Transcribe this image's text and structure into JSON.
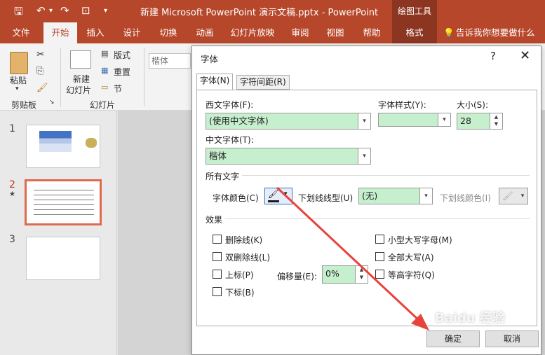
{
  "window": {
    "title": "新建 Microsoft PowerPoint 演示文稿.pptx  -  PowerPoint",
    "context_tab_group": "绘图工具"
  },
  "ribbon_tabs": [
    "文件",
    "开始",
    "插入",
    "设计",
    "切换",
    "动画",
    "幻灯片放映",
    "审阅",
    "视图",
    "帮助",
    "格式"
  ],
  "tell_me": "告诉我你想要做什么",
  "ribbon": {
    "paste": "粘贴",
    "clipboard_group": "剪贴板",
    "new_slide_line1": "新建",
    "new_slide_line2": "幻灯片",
    "layout": "版式",
    "reset": "重置",
    "section": "节",
    "slides_group": "幻灯片",
    "font_box": "楷体"
  },
  "slides": [
    "1",
    "2",
    "3"
  ],
  "slide2_star": "★",
  "dialog": {
    "title": "字体",
    "help": "?",
    "close": "✕",
    "tab_font": "字体(N)",
    "tab_spacing": "字符间距(R)",
    "western_font_label": "西文字体(F):",
    "western_font_value": "(使用中文字体)",
    "font_style_label": "字体样式(Y):",
    "font_style_value": "",
    "size_label": "大小(S):",
    "size_value": "28",
    "chinese_font_label": "中文字体(T):",
    "chinese_font_value": "楷体",
    "all_text_section": "所有文字",
    "font_color_label": "字体颜色(C)",
    "underline_type_label": "下划线线型(U)",
    "underline_type_value": "(无)",
    "underline_color_label": "下划线颜色(I)",
    "effects_section": "效果",
    "strike": "删除线(K)",
    "double_strike": "双删除线(L)",
    "superscript": "上标(P)",
    "subscript": "下标(B)",
    "offset_label": "偏移量(E):",
    "offset_value": "0%",
    "small_caps": "小型大写字母(M)",
    "all_caps": "全部大写(A)",
    "equal_height": "等高字符(Q)",
    "ok": "确定",
    "cancel": "取消"
  },
  "watermark": "Baidu 经验",
  "colors": {
    "accent": "#b7472a",
    "combo_fill": "#c6efce",
    "arrow": "#e8433a"
  }
}
